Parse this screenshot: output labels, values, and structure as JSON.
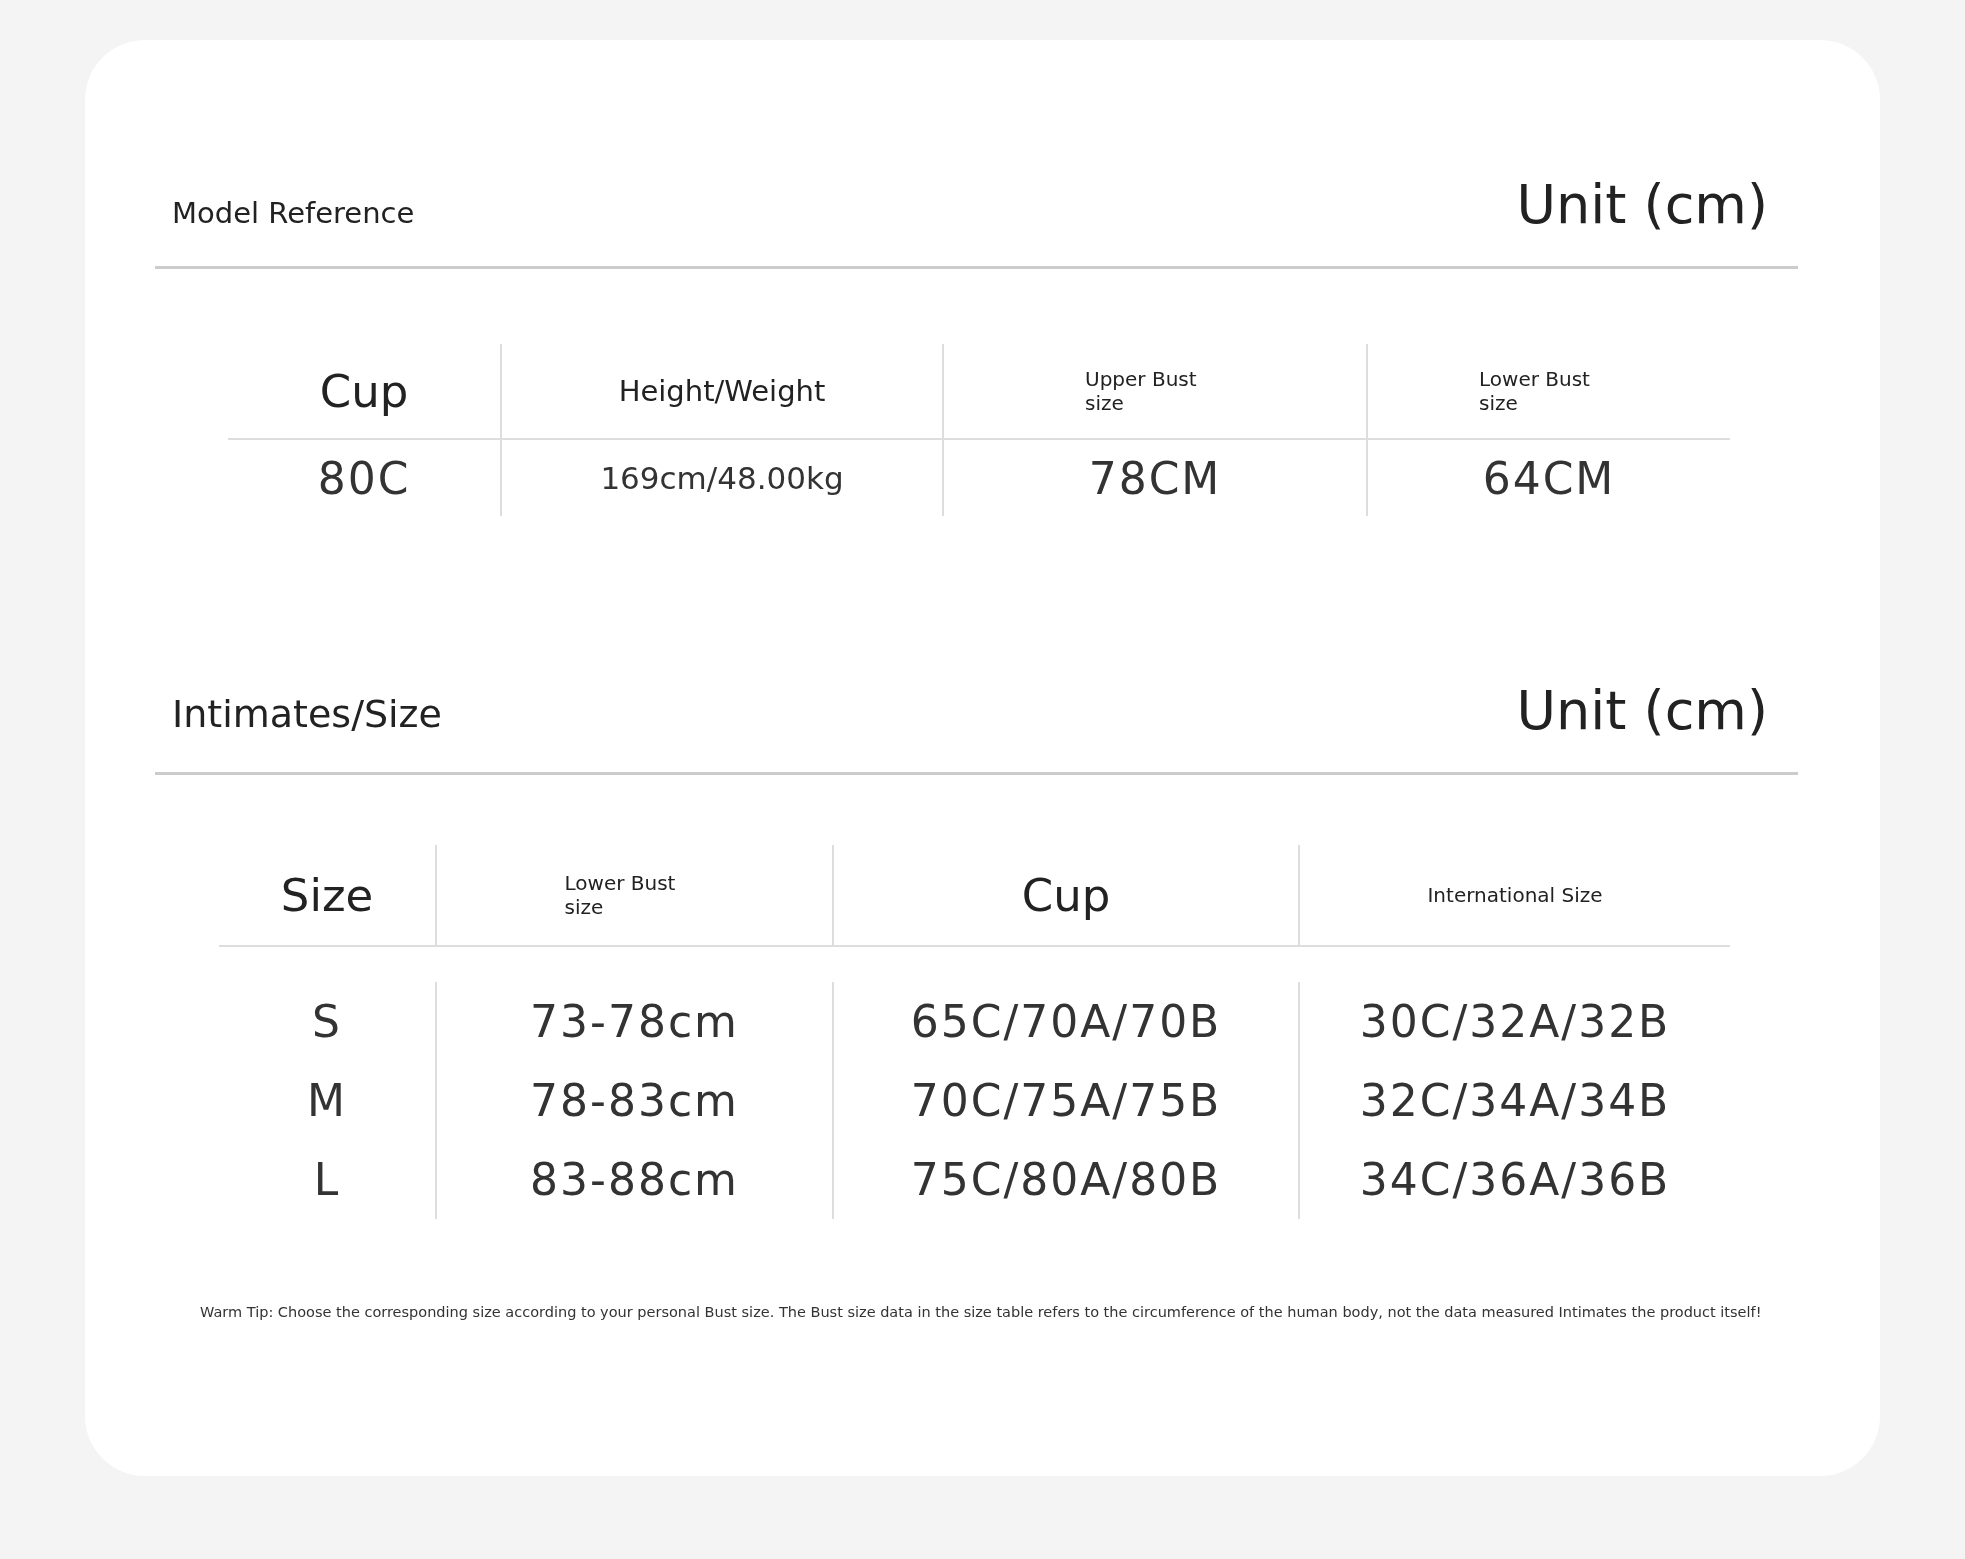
{
  "sections": [
    {
      "title": "Model Reference",
      "unit": "Unit (cm)",
      "table": {
        "columns": [
          {
            "label": "Cup",
            "kind": "big"
          },
          {
            "label": "Height/Weight",
            "kind": "medium"
          },
          {
            "label": "Upper Bust size",
            "kind": "small"
          },
          {
            "label": "Lower Bust size",
            "kind": "small"
          }
        ],
        "rows": [
          [
            "80C",
            "169cm/48.00kg",
            "78CM",
            "64CM"
          ]
        ]
      }
    },
    {
      "title": "Intimates/Size",
      "unit": "Unit (cm)",
      "table": {
        "columns": [
          {
            "label": "Size",
            "kind": "big"
          },
          {
            "label": "Lower Bust size",
            "kind": "small"
          },
          {
            "label": "Cup",
            "kind": "big"
          },
          {
            "label": "International Size",
            "kind": "small"
          }
        ],
        "rows": [
          [
            "S",
            "73-78cm",
            "65C/70A/70B",
            "30C/32A/32B"
          ],
          [
            "M",
            "78-83cm",
            "70C/75A/75B",
            "32C/34A/34B"
          ],
          [
            "L",
            "83-88cm",
            "75C/80A/80B",
            "34C/36A/36B"
          ]
        ]
      }
    }
  ],
  "tip": "Warm Tip: Choose the corresponding size according to your personal Bust size. The Bust size data in the size table refers to the circumference of the human body, not the data measured Intimates the product itself!"
}
